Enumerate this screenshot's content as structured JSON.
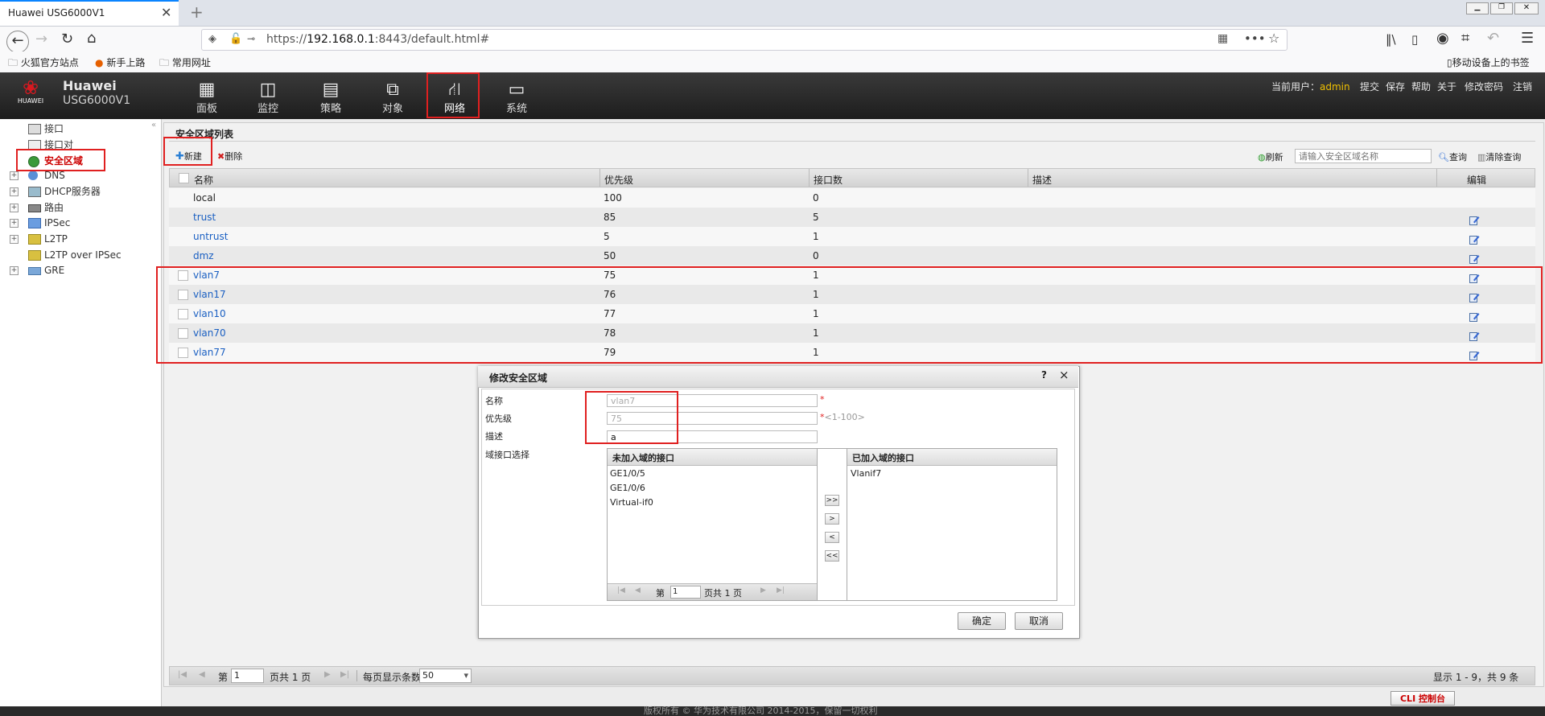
{
  "browser": {
    "tab_title": "Huawei USG6000V1",
    "url_proto": "https://",
    "url_host": "192.168.0.1",
    "url_rest": ":8443/default.html#",
    "bookmarks": [
      "火狐官方站点",
      "新手上路",
      "常用网址"
    ],
    "mobile_bookmarks": "移动设备上的书签"
  },
  "app": {
    "brand": "HUAWEI",
    "product_line1": "Huawei",
    "product_line2": "USG6000V1",
    "nav": [
      "面板",
      "监控",
      "策略",
      "对象",
      "网络",
      "系统"
    ],
    "user_label": "当前用户：",
    "user_name": "admin",
    "top_links": [
      "提交",
      "保存",
      "帮助",
      "关于",
      "修改密码",
      "注销"
    ]
  },
  "sidebar": {
    "items": [
      {
        "label": "接口",
        "expandable": false
      },
      {
        "label": "接口对",
        "expandable": false
      },
      {
        "label": "安全区域",
        "expandable": false
      },
      {
        "label": "DNS",
        "expandable": true
      },
      {
        "label": "DHCP服务器",
        "expandable": true
      },
      {
        "label": "路由",
        "expandable": true
      },
      {
        "label": "IPSec",
        "expandable": true
      },
      {
        "label": "L2TP",
        "expandable": true
      },
      {
        "label": "L2TP over IPSec",
        "expandable": false
      },
      {
        "label": "GRE",
        "expandable": true
      }
    ]
  },
  "main": {
    "panel_title": "安全区域列表",
    "new_label": "新建",
    "delete_label": "删除",
    "refresh_label": "刷新",
    "search_placeholder": "请输入安全区域名称",
    "query_label": "查询",
    "clear_label": "清除查询",
    "columns": [
      "名称",
      "优先级",
      "接口数",
      "描述",
      "编辑"
    ],
    "rows": [
      {
        "name": "local",
        "priority": "100",
        "ifcount": "0",
        "desc": "",
        "link": false,
        "checkbox": false,
        "edit": false
      },
      {
        "name": "trust",
        "priority": "85",
        "ifcount": "5",
        "desc": "",
        "link": true,
        "checkbox": false,
        "edit": true
      },
      {
        "name": "untrust",
        "priority": "5",
        "ifcount": "1",
        "desc": "",
        "link": true,
        "checkbox": false,
        "edit": true
      },
      {
        "name": "dmz",
        "priority": "50",
        "ifcount": "0",
        "desc": "",
        "link": true,
        "checkbox": false,
        "edit": true
      },
      {
        "name": "vlan7",
        "priority": "75",
        "ifcount": "1",
        "desc": "",
        "link": true,
        "checkbox": true,
        "edit": true
      },
      {
        "name": "vlan17",
        "priority": "76",
        "ifcount": "1",
        "desc": "",
        "link": true,
        "checkbox": true,
        "edit": true
      },
      {
        "name": "vlan10",
        "priority": "77",
        "ifcount": "1",
        "desc": "",
        "link": true,
        "checkbox": true,
        "edit": true
      },
      {
        "name": "vlan70",
        "priority": "78",
        "ifcount": "1",
        "desc": "",
        "link": true,
        "checkbox": true,
        "edit": true
      },
      {
        "name": "vlan77",
        "priority": "79",
        "ifcount": "1",
        "desc": "",
        "link": true,
        "checkbox": true,
        "edit": true
      }
    ],
    "pager": {
      "page_prefix": "第",
      "page_value": "1",
      "page_suffix": "页共 1 页",
      "per_page_label": "每页显示条数",
      "per_page_value": "50",
      "summary": "显示 1 - 9，共 9 条"
    }
  },
  "dialog": {
    "title": "修改安全区域",
    "help": "?",
    "close": "×",
    "name_label": "名称",
    "name_value": "vlan7",
    "priority_label": "优先级",
    "priority_value": "75",
    "priority_hint": "<1-100>",
    "required_mark": "*",
    "desc_label": "描述",
    "desc_value": "a",
    "iface_label": "域接口选择",
    "left_header": "未加入域的接口",
    "left_items": [
      "GE1/0/5",
      "GE1/0/6",
      "Virtual-if0"
    ],
    "right_header": "已加入域的接口",
    "right_items": [
      "Vlanif7"
    ],
    "move_buttons": [
      ">>",
      ">",
      "<",
      "<<"
    ],
    "pager_prefix": "第",
    "pager_value": "1",
    "pager_suffix": "页共 1 页",
    "ok": "确定",
    "cancel": "取消"
  },
  "footer": {
    "copyright": "版权所有 © 华为技术有限公司 2014-2015，保留一切权利",
    "cli_label": "CLI 控制台"
  },
  "colors": {
    "accent_red": "#e02020",
    "link_blue": "#1a5fc2",
    "user_yellow": "#f0c000"
  }
}
